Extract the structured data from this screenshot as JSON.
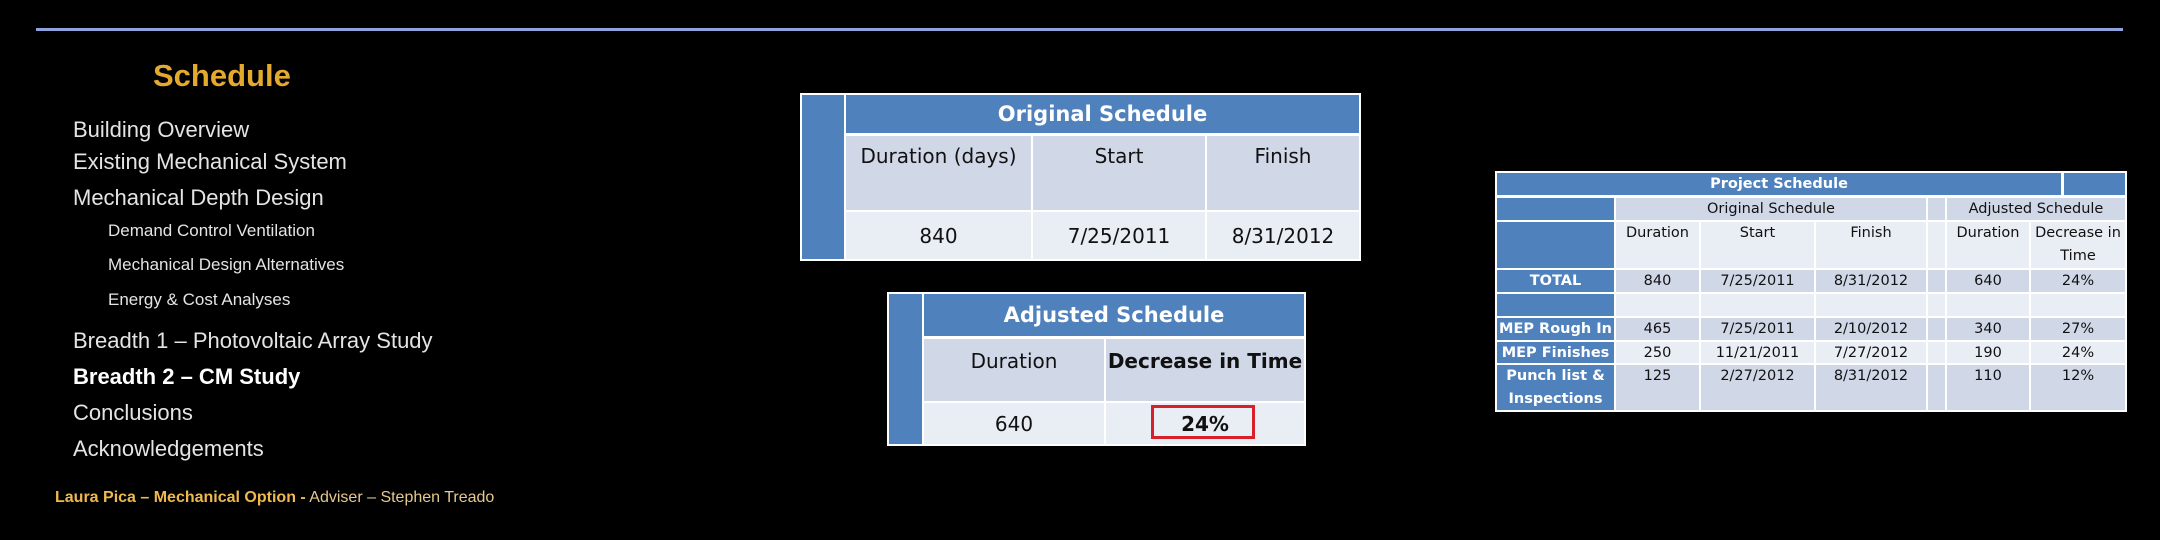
{
  "slide": {
    "title": "Schedule",
    "nav": [
      {
        "label": "Building Overview",
        "level": 1,
        "active": false
      },
      {
        "label": "Existing Mechanical System",
        "level": 1,
        "active": false
      },
      {
        "label": "Mechanical Depth Design",
        "level": 1,
        "active": false
      },
      {
        "label": "Demand Control Ventilation",
        "level": 2,
        "active": false
      },
      {
        "label": "Mechanical Design Alternatives",
        "level": 2,
        "active": false
      },
      {
        "label": "Energy & Cost Analyses",
        "level": 2,
        "active": false
      },
      {
        "label": "Breadth 1 – Photovoltaic Array Study",
        "level": 1,
        "active": false
      },
      {
        "label": "Breadth 2 – CM Study",
        "level": 1,
        "active": true
      },
      {
        "label": "Conclusions",
        "level": 1,
        "active": false
      },
      {
        "label": "Acknowledgements",
        "level": 1,
        "active": false
      }
    ],
    "footer": {
      "author": "Laura Pica – Mechanical Option -",
      "adviser": "Adviser – Stephen Treado"
    },
    "colors": {
      "accent_title": "#e3aa2d",
      "rule": "#8fa4dc",
      "table_blue": "#4f81bd",
      "band_dark": "#d0d8e8",
      "band_light": "#e9edf4",
      "highlight": "#d8202a"
    }
  },
  "original_schedule": {
    "title": "Original Schedule",
    "headers": [
      "Duration (days)",
      "Start",
      "Finish"
    ],
    "row": [
      "840",
      "7/25/2011",
      "8/31/2012"
    ]
  },
  "adjusted_schedule": {
    "title": "Adjusted Schedule",
    "headers": [
      "Duration",
      "Decrease in Time"
    ],
    "row": [
      "640",
      "24%"
    ],
    "highlighted_value": "24%"
  },
  "project_schedule": {
    "title": "Project Schedule",
    "group_headers": {
      "original": "Original Schedule",
      "adjusted": "Adjusted Schedule"
    },
    "columns": [
      "Duration",
      "Start",
      "Finish",
      "Duration",
      "Decrease in Time"
    ],
    "rows": [
      {
        "label": "TOTAL",
        "values": [
          "840",
          "7/25/2011",
          "8/31/2012",
          "640",
          "24%"
        ]
      },
      {
        "label": "",
        "values": [
          "",
          "",
          "",
          "",
          ""
        ]
      },
      {
        "label": "MEP Rough In",
        "values": [
          "465",
          "7/25/2011",
          "2/10/2012",
          "340",
          "27%"
        ]
      },
      {
        "label": "MEP Finishes",
        "values": [
          "250",
          "11/21/2011",
          "7/27/2012",
          "190",
          "24%"
        ]
      },
      {
        "label": "Punch list & Inspections",
        "values": [
          "125",
          "2/27/2012",
          "8/31/2012",
          "110",
          "12%"
        ]
      }
    ]
  }
}
